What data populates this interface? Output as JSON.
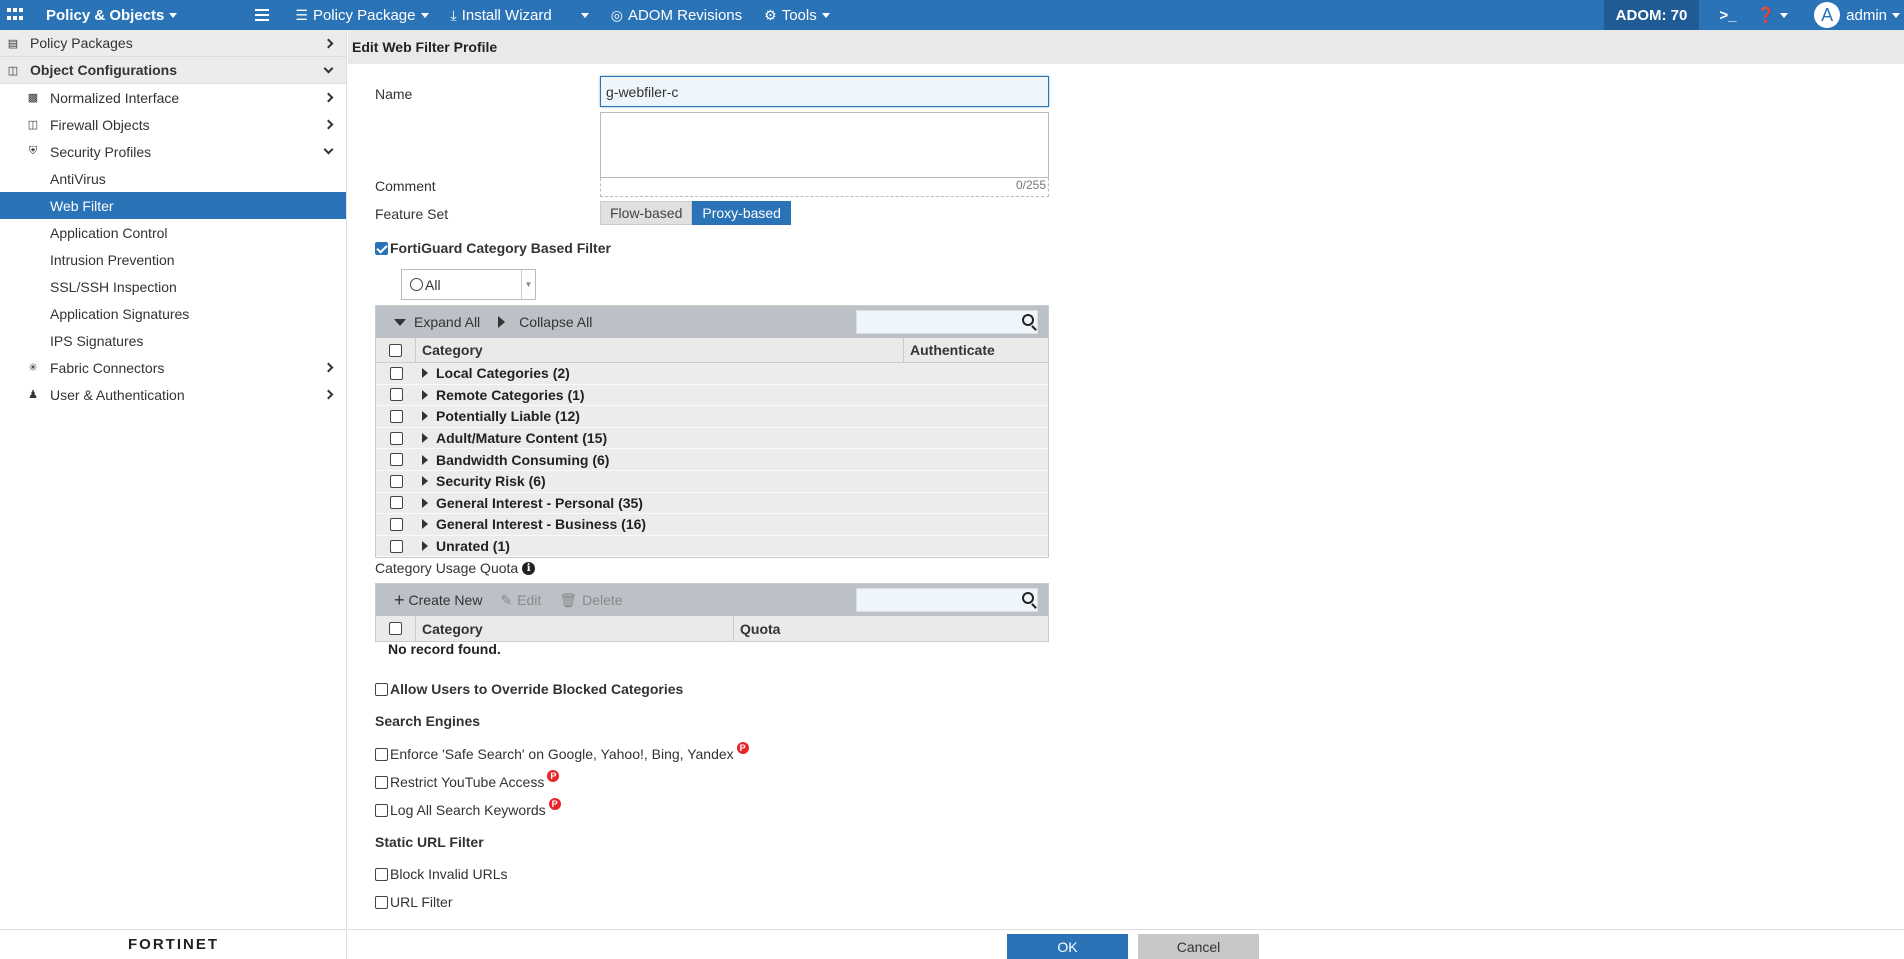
{
  "topbar": {
    "module": "Policy & Objects",
    "nav": [
      {
        "icon": "policy-package-icon",
        "glyph": "☰",
        "label": "Policy Package"
      },
      {
        "icon": "install-wizard-icon",
        "glyph": "⤓",
        "label": "Install Wizard"
      },
      {
        "icon": "adom-revisions-icon",
        "glyph": "◎",
        "label": "ADOM Revisions"
      },
      {
        "icon": "tools-icon",
        "glyph": "⚙",
        "label": "Tools"
      }
    ],
    "adom": "ADOM: 70",
    "avatar_letter": "A",
    "user": "admin"
  },
  "sidebar": {
    "policy_packages": "Policy Packages",
    "object_configurations": "Object Configurations",
    "normalized_interface": "Normalized Interface",
    "firewall_objects": "Firewall Objects",
    "security_profiles": "Security Profiles",
    "profiles": [
      "AntiVirus",
      "Web Filter",
      "Application Control",
      "Intrusion Prevention",
      "SSL/SSH Inspection",
      "Application Signatures",
      "IPS Signatures"
    ],
    "fabric_connectors": "Fabric Connectors",
    "user_authentication": "User & Authentication",
    "logo": "FORTINET"
  },
  "page": {
    "title": "Edit Web Filter Profile",
    "name_label": "Name",
    "name_value": "g-webfiler-c",
    "comment_label": "Comment",
    "comment_counter": "0/255",
    "feature_set_label": "Feature Set",
    "feature_flow": "Flow-based",
    "feature_proxy": "Proxy-based",
    "fortiguard_label": "FortiGuard Category Based Filter",
    "filter_select": "All",
    "expand_all": "Expand All",
    "collapse_all": "Collapse All",
    "col_category": "Category",
    "col_authenticate": "Authenticate",
    "categories": [
      "Local Categories (2)",
      "Remote Categories (1)",
      "Potentially Liable (12)",
      "Adult/Mature Content (15)",
      "Bandwidth Consuming (6)",
      "Security Risk (6)",
      "General Interest - Personal (35)",
      "General Interest - Business (16)",
      "Unrated (1)"
    ],
    "quota_label": "Category Usage Quota",
    "create_new": "Create New",
    "edit": "Edit",
    "delete": "Delete",
    "col_quota": "Quota",
    "no_record": "No record found.",
    "allow_override": "Allow Users to Override Blocked Categories",
    "search_engines": "Search Engines",
    "safe_search": "Enforce 'Safe Search' on Google, Yahoo!, Bing, Yandex",
    "restrict_youtube": "Restrict YouTube Access",
    "log_keywords": "Log All Search Keywords",
    "static_url_filter": "Static URL Filter",
    "block_invalid": "Block Invalid URLs",
    "url_filter": "URL Filter",
    "ok": "OK",
    "cancel": "Cancel",
    "badge": "P"
  }
}
